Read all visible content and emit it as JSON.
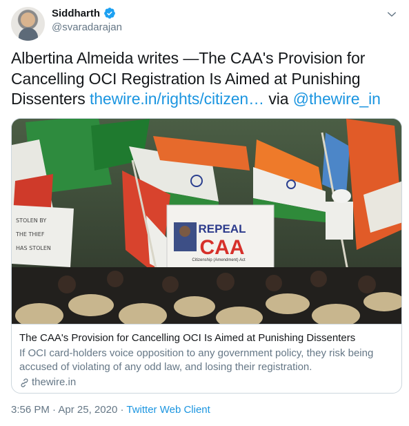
{
  "author": {
    "name": "Siddharth",
    "handle": "@svaradarajan"
  },
  "tweet": {
    "text": "Albertina Almeida writes —The CAA's Provision for Cancelling OCI Registration Is Aimed at Punishing Dissenters",
    "link_text": "thewire.in/rights/citizen…",
    "via_text": "via",
    "mention": "@thewire_in"
  },
  "card": {
    "image_sign_line1": "REPEAL",
    "image_sign_line2": "CAA",
    "image_sign_line3": "Citizenship (Amendment) Act",
    "image_placard_text": "HAS STOLEN BY THE THIEF HAS STOLEN",
    "title": "The CAA's Provision for Cancelling OCI Is Aimed at Punishing Dissenters",
    "description": "If OCI card-holders voice opposition to any government policy, they risk being accused of violating of any odd law, and losing their registration.",
    "domain": "thewire.in"
  },
  "meta": {
    "time": "3:56 PM",
    "separator": "·",
    "date": "Apr 25, 2020",
    "client": "Twitter Web Client"
  },
  "colors": {
    "link": "#1b95e0",
    "text": "#14171a",
    "secondary": "#657786",
    "border": "#ccd6dd",
    "verified": "#1da1f2"
  },
  "icons": {
    "verified": "verified-badge-icon",
    "chevron": "chevron-down-icon",
    "link": "link-icon"
  }
}
